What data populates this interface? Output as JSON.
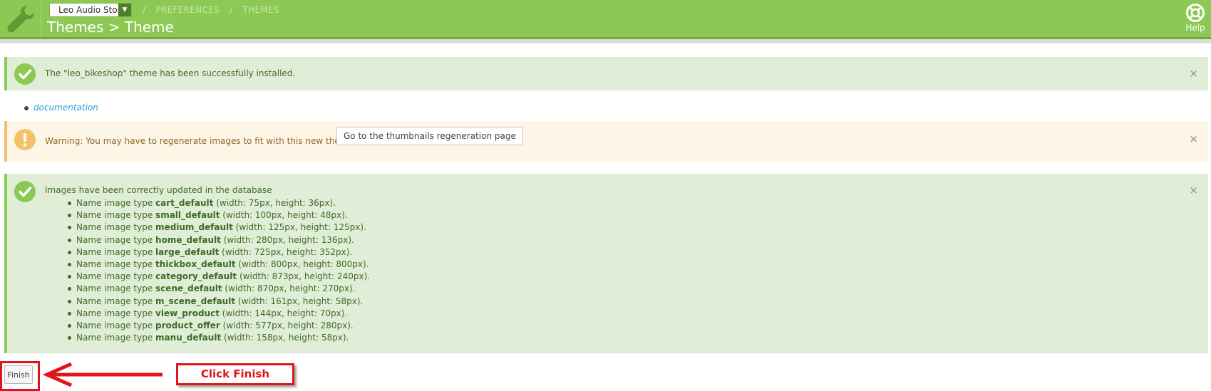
{
  "header": {
    "store_selector": "Leo Audio Store",
    "breadcrumb": [
      "/",
      "PREFERENCES",
      "/",
      "THEMES"
    ],
    "title": "Themes > Theme",
    "help_label": "Help"
  },
  "alerts": {
    "installed": "The \"leo_bikeshop\" theme has been successfully installed.",
    "documentation_link": "documentation",
    "warning": "Warning: You may have to regenerate images to fit with this new theme.",
    "regen_button": "Go to the thumbnails regeneration page",
    "images_updated": "Images have been correctly updated in the database",
    "close": "×"
  },
  "image_types": [
    {
      "prefix": "Name image type",
      "name": "cart_default",
      "dims": "(width: 75px, height: 36px)."
    },
    {
      "prefix": "Name image type",
      "name": "small_default",
      "dims": "(width: 100px, height: 48px)."
    },
    {
      "prefix": "Name image type",
      "name": "medium_default",
      "dims": "(width: 125px, height: 125px)."
    },
    {
      "prefix": "Name image type",
      "name": "home_default",
      "dims": "(width: 280px, height: 136px)."
    },
    {
      "prefix": "Name image type",
      "name": "large_default",
      "dims": "(width: 725px, height: 352px)."
    },
    {
      "prefix": "Name image type",
      "name": "thickbox_default",
      "dims": "(width: 800px, height: 800px)."
    },
    {
      "prefix": "Name image type",
      "name": "category_default",
      "dims": "(width: 873px, height: 240px)."
    },
    {
      "prefix": "Name image type",
      "name": "scene_default",
      "dims": "(width: 870px, height: 270px)."
    },
    {
      "prefix": "Name image type",
      "name": "m_scene_default",
      "dims": "(width: 161px, height: 58px)."
    },
    {
      "prefix": "Name image type",
      "name": "view_product",
      "dims": "(width: 144px, height: 70px)."
    },
    {
      "prefix": "Name image type",
      "name": "product_offer",
      "dims": "(width: 577px, height: 280px)."
    },
    {
      "prefix": "Name image type",
      "name": "manu_default",
      "dims": "(width: 158px, height: 58px)."
    }
  ],
  "footer": {
    "finish_button": "Finish",
    "callout": "Click Finish"
  },
  "colors": {
    "header_green": "#8bc954",
    "success_bg": "#e1eed7",
    "warning_bg": "#fdf6e6",
    "annotation_red": "#e0141a"
  }
}
